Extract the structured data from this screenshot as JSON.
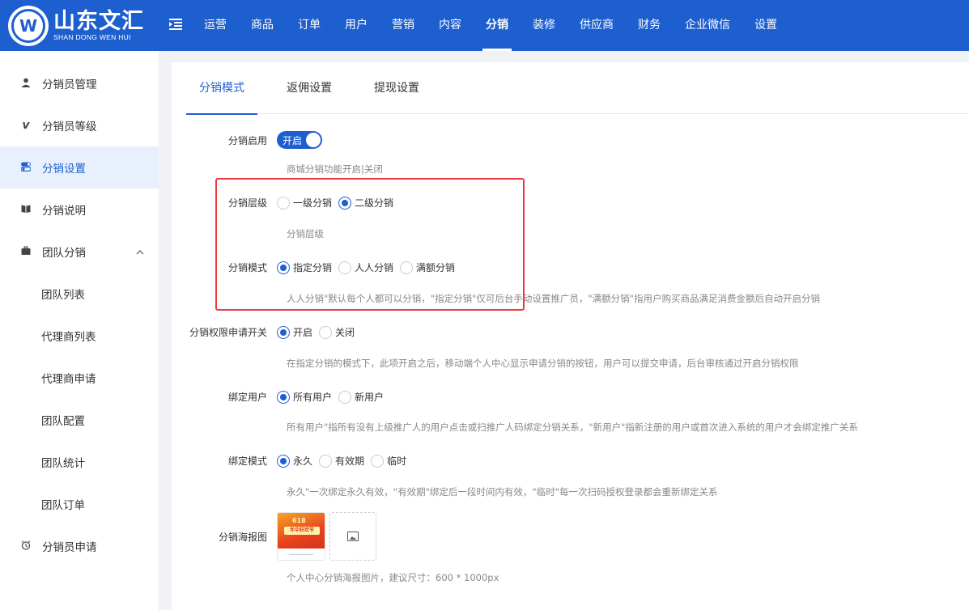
{
  "brand": {
    "name_cn": "山东文汇",
    "name_en": "SHAN DONG WEN HUI",
    "logo_letter": "W"
  },
  "colors": {
    "primary": "#1e5fcf",
    "highlight_box": "#f03a3a"
  },
  "nav": {
    "items": [
      "运营",
      "商品",
      "订单",
      "用户",
      "营销",
      "内容",
      "分销",
      "装修",
      "供应商",
      "财务",
      "企业微信",
      "设置"
    ],
    "active": "分销"
  },
  "sidebar": {
    "items": [
      {
        "label": "分销员管理",
        "icon": "user-icon"
      },
      {
        "label": "分销员等级",
        "icon": "level-v-icon"
      },
      {
        "label": "分销设置",
        "icon": "toggle-settings-icon",
        "active": true
      },
      {
        "label": "分销说明",
        "icon": "book-icon"
      },
      {
        "label": "团队分销",
        "icon": "briefcase-icon",
        "expanded": true
      }
    ],
    "subitems": [
      "团队列表",
      "代理商列表",
      "代理商申请",
      "团队配置",
      "团队统计",
      "团队订单"
    ],
    "last": {
      "label": "分销员申请",
      "icon": "alarm-clock-icon"
    }
  },
  "tabs": [
    "分销模式",
    "返佣设置",
    "提现设置"
  ],
  "form": {
    "enable": {
      "label": "分销启用",
      "switch_text": "开启",
      "help": "商城分销功能开启|关闭"
    },
    "level": {
      "label": "分销层级",
      "options": [
        "一级分销",
        "二级分销"
      ],
      "selected": 1,
      "help": "分销层级"
    },
    "mode": {
      "label": "分销模式",
      "options": [
        "指定分销",
        "人人分销",
        "满额分销"
      ],
      "selected": 0,
      "help": "人人分销\"默认每个人都可以分销，\"指定分销\"仅可后台手动设置推广员，\"满额分销\"指用户购买商品满足消费金额后自动开启分销"
    },
    "apply": {
      "label": "分销权限申请开关",
      "options": [
        "开启",
        "关闭"
      ],
      "selected": 0,
      "help": "在指定分销的模式下，此项开启之后，移动端个人中心显示申请分销的按钮，用户可以提交申请，后台审核通过开启分销权限"
    },
    "bind_user": {
      "label": "绑定用户",
      "options": [
        "所有用户",
        "新用户"
      ],
      "selected": 0,
      "help": "所有用户\"指所有没有上级推广人的用户点击或扫推广人码绑定分销关系，\"新用户\"指新注册的用户或首次进入系统的用户才会绑定推广关系"
    },
    "bind_mode": {
      "label": "绑定模式",
      "options": [
        "永久",
        "有效期",
        "临时"
      ],
      "selected": 0,
      "help": "永久\"一次绑定永久有效，\"有效期\"绑定后一段时间内有效，\"临时\"每一次扫码授权登录都会重新绑定关系"
    },
    "poster": {
      "label": "分销海报图",
      "thumb_title": "618",
      "thumb_banner": "年中狂欢节",
      "help": "个人中心分销海报图片，建议尺寸：600 * 1000px"
    }
  }
}
